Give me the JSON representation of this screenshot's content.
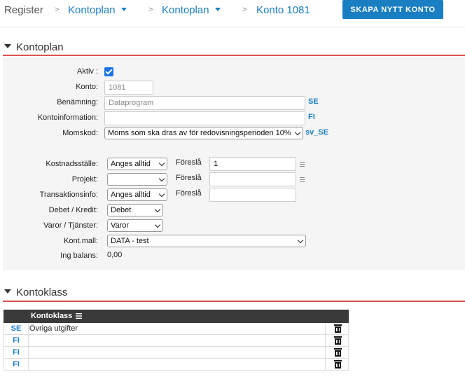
{
  "header": {
    "root": "Register",
    "crumbs": [
      "Kontoplan",
      "Kontoplan",
      "Konto 1081"
    ],
    "separator": ">",
    "create_button": "SKAPA NYTT KONTO"
  },
  "kontoplan": {
    "title": "Kontoplan",
    "aktiv_label": "Aktiv :",
    "aktiv_checked": true,
    "konto_label": "Konto:",
    "konto_value": "1081",
    "benamning_label": "Benämning:",
    "benamning_placeholder": "Dataprogram",
    "benamning_lang": "SE",
    "kontoinfo_label": "Kontoinformation:",
    "kontoinfo_value": "",
    "kontoinfo_lang": "FI",
    "momskod_label": "Momskod:",
    "momskod_value": "Moms som ska dras av för redovisningsperioden 10%",
    "momskod_lang": "sv_SE",
    "kostnadsstalle_label": "Kostnadsställe:",
    "kostnadsstalle_value": "Anges alltid",
    "foresla_label": "Föreslå",
    "kostnadsstalle_suggest": "1",
    "projekt_label": "Projekt:",
    "projekt_value": "",
    "projekt_suggest": "",
    "transaktionsinfo_label": "Transaktionsinfo:",
    "transaktionsinfo_value": "Anges alltid",
    "transaktionsinfo_suggest": "",
    "debet_label": "Debet / Kredit:",
    "debet_value": "Debet",
    "varor_label": "Varor / Tjänster:",
    "varor_value": "Varor",
    "kontmall_label": "Kont.mall:",
    "kontmall_value": "DATA - test",
    "ingbalans_label": "Ing balans:",
    "ingbalans_value": "0,00"
  },
  "kontoklass": {
    "title": "Kontoklass",
    "column_header": "Kontoklass",
    "rows": [
      {
        "lang": "SE",
        "text": "Övriga utgifter"
      },
      {
        "lang": "FI",
        "text": ""
      },
      {
        "lang": "FI",
        "text": ""
      },
      {
        "lang": "FI",
        "text": ""
      }
    ]
  },
  "colors": {
    "accent": "#1a7ec2",
    "section_line": "#d9534f",
    "table_header": "#3a3a3a"
  }
}
